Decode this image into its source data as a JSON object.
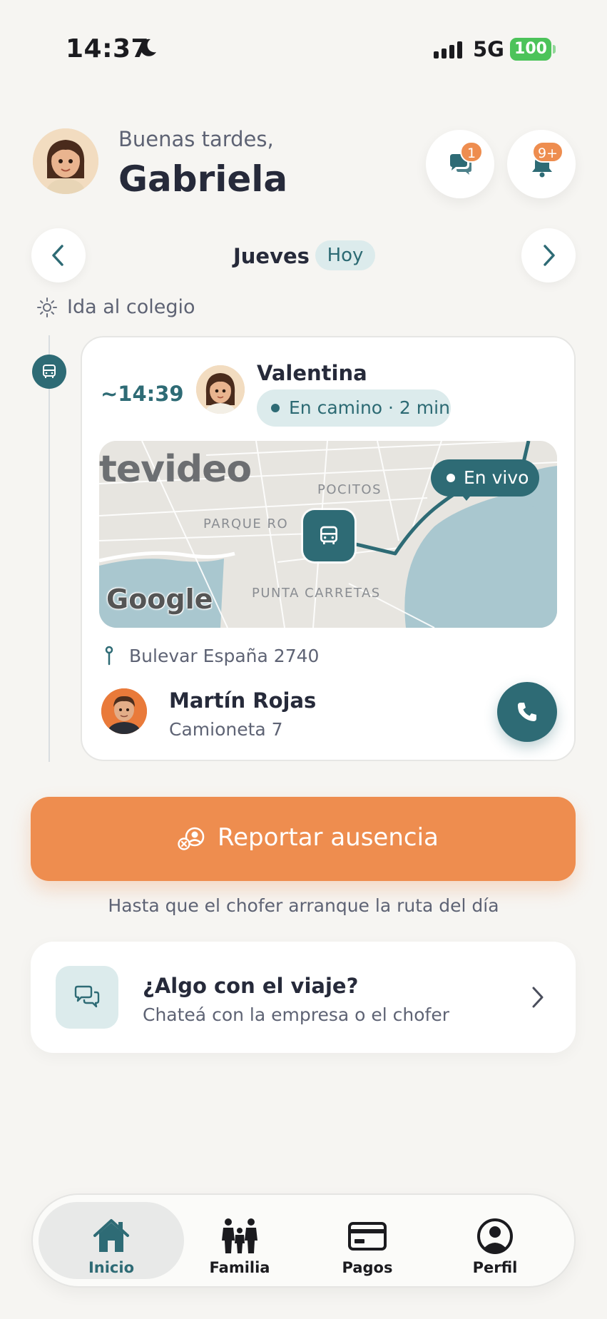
{
  "status_bar": {
    "time": "14:37",
    "network": "5G",
    "battery": "100"
  },
  "header": {
    "greeting": "Buenas tardes,",
    "user_name": "Gabriela",
    "chat_badge": "1",
    "notification_badge": "9+"
  },
  "day_selector": {
    "day": "Jueves",
    "today_label": "Hoy"
  },
  "route": {
    "label": "Ida al colegio"
  },
  "trip": {
    "eta": "~14:39",
    "child_name": "Valentina",
    "status": "En camino · 2 min",
    "map": {
      "city_text": "tevideo",
      "areas": [
        "POCITOS",
        "PARQUE RO",
        "PUNTA CARRETAS"
      ],
      "live_label": "En vivo",
      "attribution": "Google"
    },
    "address": "Bulevar España 2740",
    "driver": {
      "name": "Martín Rojas",
      "vehicle": "Camioneta 7"
    }
  },
  "report": {
    "button_label": "Reportar ausencia",
    "hint": "Hasta que el chofer arranque la ruta del día"
  },
  "help": {
    "title": "¿Algo con el viaje?",
    "subtitle": "Chateá con la empresa o el chofer"
  },
  "bottom_nav": {
    "items": [
      {
        "label": "Inicio",
        "icon": "home-icon",
        "active": true
      },
      {
        "label": "Familia",
        "icon": "family-icon",
        "active": false
      },
      {
        "label": "Pagos",
        "icon": "card-icon",
        "active": false
      },
      {
        "label": "Perfil",
        "icon": "profile-icon",
        "active": false
      }
    ]
  },
  "colors": {
    "accent": "#2e6b75",
    "accent_light": "#dcebec",
    "orange": "#ee8d4f",
    "background": "#f6f5f2",
    "battery": "#4cc35a"
  }
}
